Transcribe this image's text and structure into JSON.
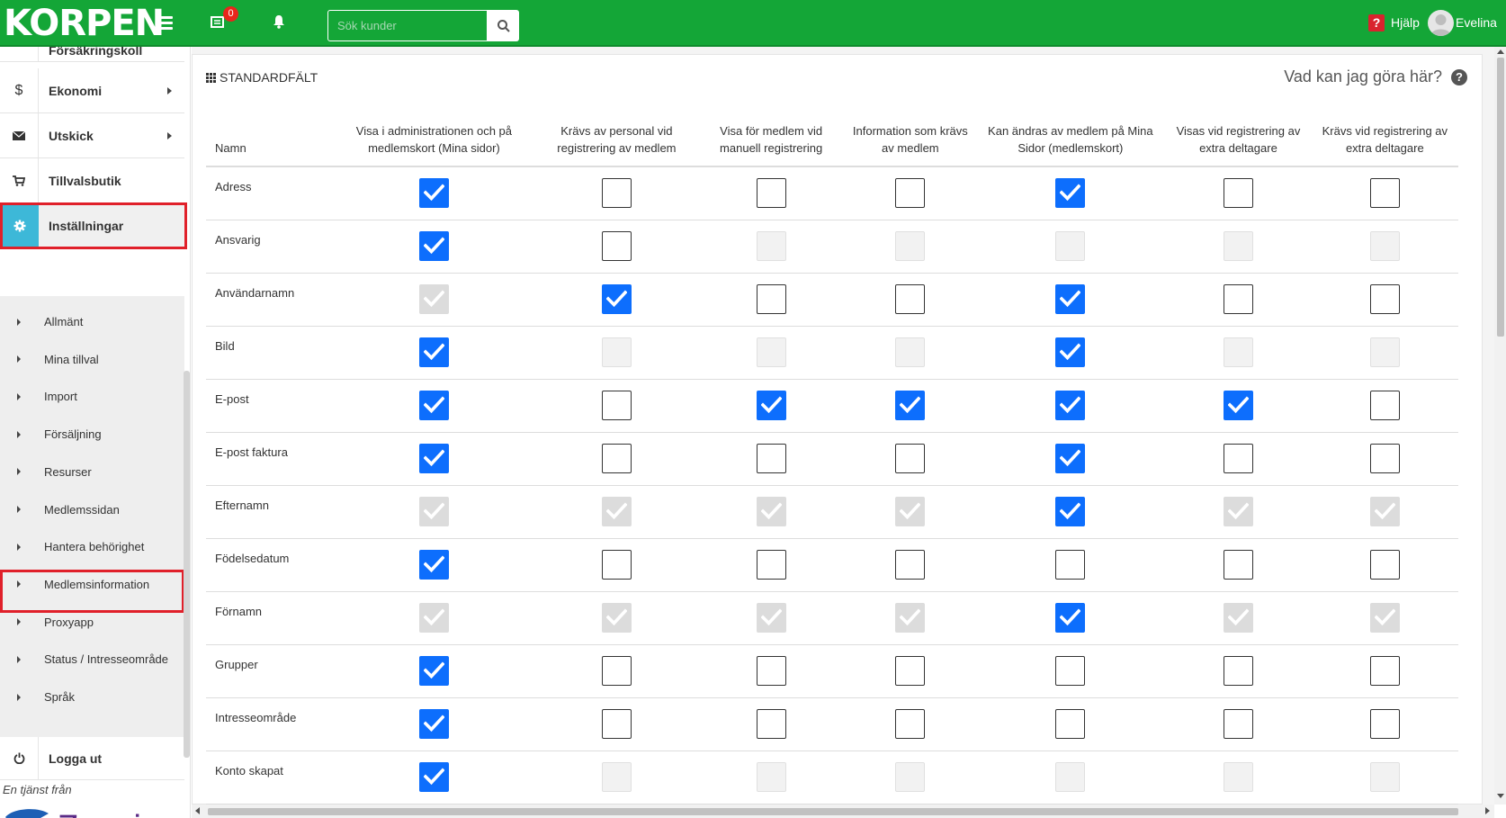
{
  "topbar": {
    "logo": "KORPEN",
    "cart_count": "0",
    "search_placeholder": "Sök kunder",
    "help_label": "Hjälp",
    "user_name": "Evelina",
    "color": "#14a637"
  },
  "sidebar": {
    "partial_item": "Försäkringskoll",
    "items": [
      {
        "label": "Ekonomi",
        "icon": "dollar-icon",
        "has_submenu": true
      },
      {
        "label": "Utskick",
        "icon": "envelope-icon",
        "has_submenu": true
      },
      {
        "label": "Tillvalsbutik",
        "icon": "cart-icon",
        "has_submenu": false
      },
      {
        "label": "Inställningar",
        "icon": "gear-icon",
        "has_submenu": false,
        "active": true
      }
    ],
    "submenu": [
      "Allmänt",
      "Mina tillval",
      "Import",
      "Försäljning",
      "Resurser",
      "Medlemssidan",
      "Hantera behörighet",
      "Medlemsinformation",
      "Proxyapp",
      "Status / Intresseområde",
      "Språk"
    ],
    "logout": "Logga ut",
    "brand_note": "En tjänst från",
    "brand_name": "Zoezi"
  },
  "panel": {
    "title": "STANDARDFÄLT",
    "help": "Vad kan jag göra här?",
    "columns": [
      "Namn",
      "Visa i administrationen och på medlemskort (Mina sidor)",
      "Krävs av personal vid registrering av medlem",
      "Visa för medlem vid manuell registrering",
      "Information som krävs av medlem",
      "Kan ändras av medlem på Mina Sidor (medlemskort)",
      "Visas vid registrering av extra deltagare",
      "Krävs vid registrering av extra deltagare"
    ],
    "rows": [
      {
        "name": "Adress",
        "cells": [
          "checked",
          "unchecked",
          "unchecked",
          "unchecked",
          "checked",
          "unchecked",
          "unchecked"
        ]
      },
      {
        "name": "Ansvarig",
        "cells": [
          "checked",
          "unchecked",
          "disabled",
          "disabled",
          "disabled",
          "disabled",
          "disabled"
        ]
      },
      {
        "name": "Användarnamn",
        "cells": [
          "disabled-checked",
          "checked",
          "unchecked",
          "unchecked",
          "checked",
          "unchecked",
          "unchecked"
        ]
      },
      {
        "name": "Bild",
        "cells": [
          "checked",
          "disabled",
          "disabled",
          "disabled",
          "checked",
          "disabled",
          "disabled"
        ]
      },
      {
        "name": "E-post",
        "cells": [
          "checked",
          "unchecked",
          "checked",
          "checked",
          "checked",
          "checked",
          "unchecked"
        ]
      },
      {
        "name": "E-post faktura",
        "cells": [
          "checked",
          "unchecked",
          "unchecked",
          "unchecked",
          "checked",
          "unchecked",
          "unchecked"
        ]
      },
      {
        "name": "Efternamn",
        "cells": [
          "disabled-checked",
          "disabled-checked",
          "disabled-checked",
          "disabled-checked",
          "checked",
          "disabled-checked",
          "disabled-checked"
        ]
      },
      {
        "name": "Födelsedatum",
        "cells": [
          "checked",
          "unchecked",
          "unchecked",
          "unchecked",
          "unchecked",
          "unchecked",
          "unchecked"
        ]
      },
      {
        "name": "Förnamn",
        "cells": [
          "disabled-checked",
          "disabled-checked",
          "disabled-checked",
          "disabled-checked",
          "checked",
          "disabled-checked",
          "disabled-checked"
        ]
      },
      {
        "name": "Grupper",
        "cells": [
          "checked",
          "unchecked",
          "unchecked",
          "unchecked",
          "unchecked",
          "unchecked",
          "unchecked"
        ]
      },
      {
        "name": "Intresseområde",
        "cells": [
          "checked",
          "unchecked",
          "unchecked",
          "unchecked",
          "unchecked",
          "unchecked",
          "unchecked"
        ]
      },
      {
        "name": "Konto skapat",
        "cells": [
          "checked",
          "disabled",
          "disabled",
          "disabled",
          "disabled",
          "disabled",
          "disabled"
        ]
      }
    ]
  },
  "colors": {
    "accent": "#0d6efd",
    "highlight": "#e0202a",
    "active_icon_bg": "#3db8d8"
  }
}
